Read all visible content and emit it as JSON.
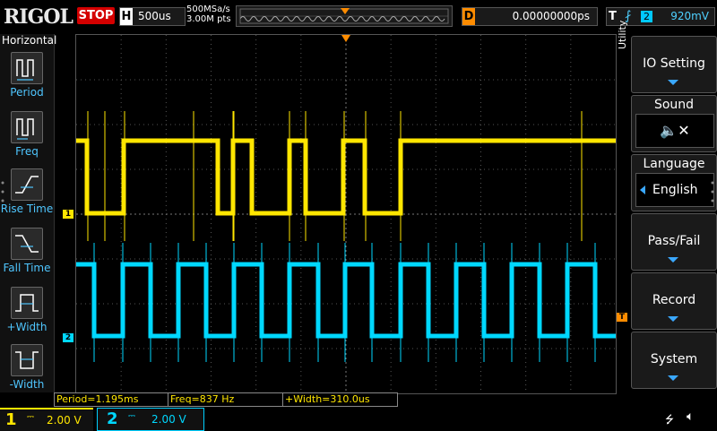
{
  "brand": "RIGOL",
  "run_status": "STOP",
  "horizontal": {
    "key": "H",
    "timebase": "500us"
  },
  "sample_rate": "500MSa/s",
  "memory_depth": "3.00M pts",
  "delay": {
    "key": "D",
    "value": "0.00000000ps"
  },
  "trigger": {
    "key": "T",
    "edge_icon": "rising-edge-icon",
    "source": "2",
    "level": "920mV"
  },
  "left_menu": {
    "title": "Horizontal",
    "items": [
      {
        "label": "Period",
        "icon": "period-icon"
      },
      {
        "label": "Freq",
        "icon": "frequency-icon"
      },
      {
        "label": "Rise Time",
        "icon": "rise-time-icon"
      },
      {
        "label": "Fall Time",
        "icon": "fall-time-icon"
      },
      {
        "label": "+Width",
        "icon": "positive-width-icon"
      },
      {
        "label": "-Width",
        "icon": "negative-width-icon"
      }
    ]
  },
  "right_menu": {
    "side_label": "Utility",
    "buttons": [
      {
        "label": "IO Setting",
        "value": ""
      },
      {
        "label": "Sound",
        "value": ""
      },
      {
        "label": "Language",
        "value": "English"
      },
      {
        "label": "Pass/Fail",
        "value": ""
      },
      {
        "label": "Record",
        "value": ""
      },
      {
        "label": "System",
        "value": ""
      }
    ]
  },
  "measurements": [
    {
      "text": "Period=1.195ms"
    },
    {
      "text": "Freq=837 Hz"
    },
    {
      "text": "+Width=310.0us"
    }
  ],
  "channels": [
    {
      "number": "1",
      "coupling": "DC",
      "scale": "2.00 V",
      "color": "#ffe600"
    },
    {
      "number": "2",
      "coupling": "DC",
      "scale": "2.00 V",
      "color": "#00d8ff"
    }
  ],
  "markers": {
    "ch1": "1",
    "ch2": "2",
    "trigger": "T"
  },
  "colors": {
    "ch1": "#ffe600",
    "ch2": "#00d8ff",
    "trigger": "#ff8c00",
    "menu_accent": "#3aa8ff"
  }
}
